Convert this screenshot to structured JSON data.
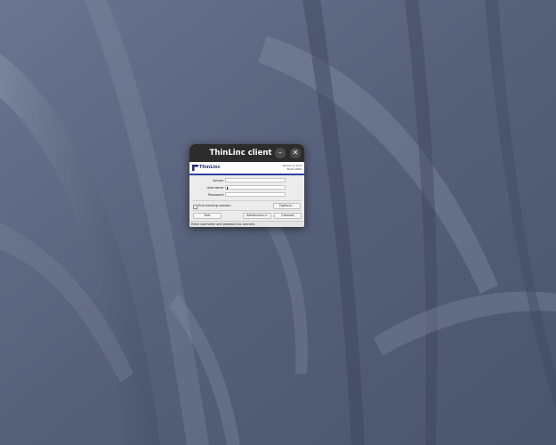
{
  "window": {
    "title": "ThinLinc client"
  },
  "header": {
    "logo_text": "ThinLinc",
    "version_line1": "Version 4.12.0",
    "version_line2": "Build 1690"
  },
  "form": {
    "server_label": "Server:",
    "server_value": "",
    "username_label": "Username:",
    "username_value": "",
    "password_label": "Password:",
    "password_value": ""
  },
  "options": {
    "end_session_label": "End existing session",
    "end_session_checked": false,
    "options_button": "Options..."
  },
  "buttons": {
    "exit": "Exit",
    "advanced": "Advanced<<",
    "connect": "Connect"
  },
  "status": {
    "text": "Enter username and password to connect."
  },
  "colors": {
    "accent": "#2b3f9e",
    "titlebar": "#2c2c2c",
    "desktop": "#55607a"
  },
  "icons": {
    "minimize": "minimize-icon",
    "close": "close-icon",
    "logo": "thinlinc-logo-icon"
  }
}
